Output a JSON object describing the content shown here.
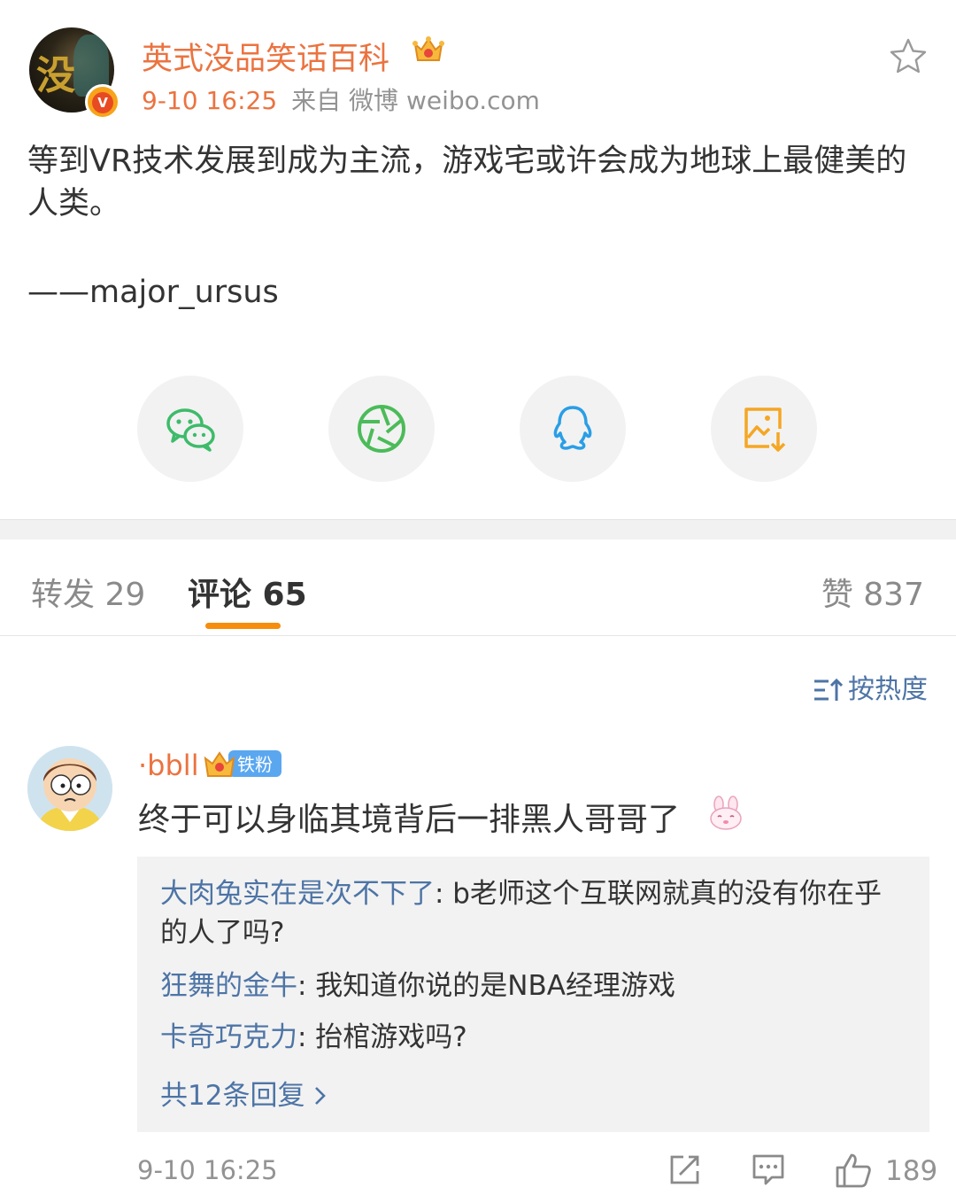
{
  "post": {
    "author": "英式没品笑话百科",
    "verified_badge": "V",
    "time": "9-10 16:25",
    "source": "来自 微博 weibo.com",
    "text": "等到VR技术发展到成为主流，游戏宅或许会成为地球上最健美的人类。",
    "signature": "——major_ursus"
  },
  "share_icons": [
    "wechat-icon",
    "moments-icon",
    "qq-icon",
    "save-image-icon"
  ],
  "tabs": {
    "repost": "转发 29",
    "comment": "评论 65",
    "like": "赞 837"
  },
  "sort_label": "按热度",
  "comment": {
    "author": "·bbll",
    "fan_badge": "铁粉",
    "text": "终于可以身临其境背后一排黑人哥哥了",
    "replies": [
      {
        "name": "大肉兔实在是次不下了",
        "text": ": b老师这个互联网就真的没有你在乎的人了吗?"
      },
      {
        "name": "狂舞的金牛",
        "text": ": 我知道你说的是NBA经理游戏"
      },
      {
        "name": "卡奇巧克力",
        "text": ": 抬棺游戏吗?"
      }
    ],
    "more_replies": "共12条回复 ",
    "time": "9-10 16:25",
    "likes": "189"
  },
  "colors": {
    "accent_orange": "#eb7340",
    "link_blue": "#4d74a6",
    "tab_underline": "#f68d0d"
  }
}
